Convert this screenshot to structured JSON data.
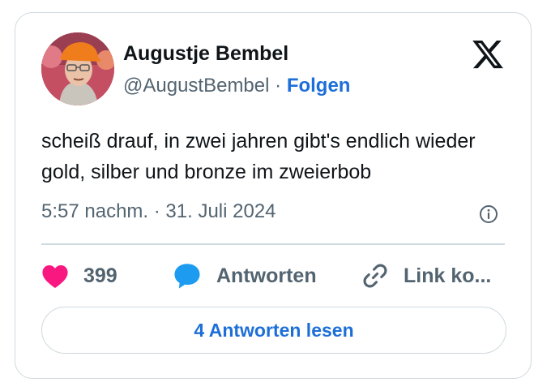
{
  "author": {
    "name": "Augustje Bembel",
    "handle": "@AugustBembel",
    "separator": "·",
    "follow_label": "Folgen"
  },
  "tweet": {
    "text": "scheiß drauf, in zwei jahren gibt's endlich wieder gold, silber und bronze im zweierbob",
    "timestamp": "5:57 nachm. · 31. Juli 2024"
  },
  "actions": {
    "likes_count": "399",
    "reply_label": "Antworten",
    "copy_link_label": "Link ko..."
  },
  "read_replies_label": "4 Antworten lesen",
  "icons": {
    "logo": "x-logo-icon",
    "info": "info-icon",
    "like": "heart-icon",
    "reply": "speech-bubble-icon",
    "link": "link-icon"
  },
  "colors": {
    "accent": "#1d6fd8",
    "like": "#f91880",
    "muted": "#536471",
    "border": "#cfd9de"
  }
}
